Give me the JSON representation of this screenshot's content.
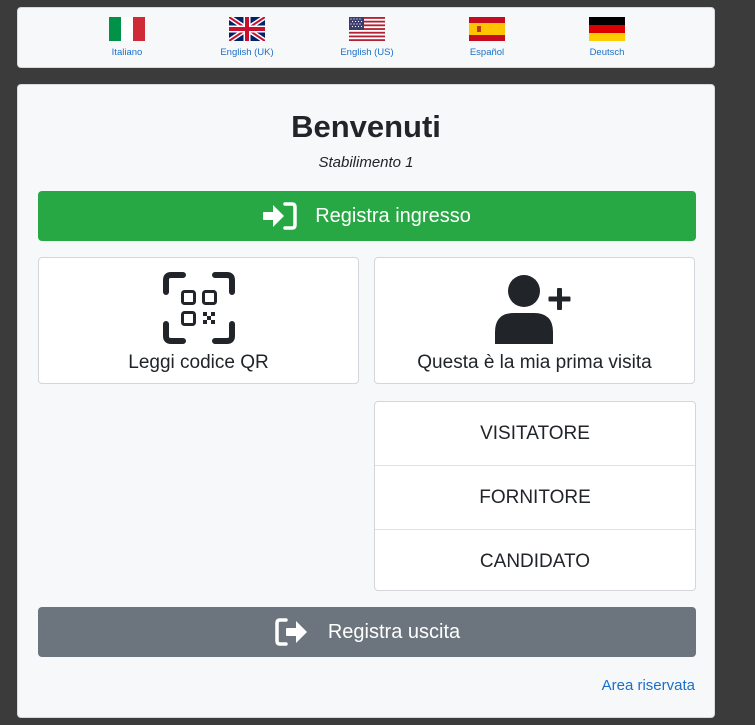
{
  "languages": [
    {
      "label": "Italiano",
      "flag": "it-flag-icon"
    },
    {
      "label": "English (UK)",
      "flag": "uk-flag-icon"
    },
    {
      "label": "English (US)",
      "flag": "us-flag-icon"
    },
    {
      "label": "Español",
      "flag": "es-flag-icon"
    },
    {
      "label": "Deutsch",
      "flag": "de-flag-icon"
    }
  ],
  "main": {
    "title": "Benvenuti",
    "subtitle": "Stabilimento 1",
    "checkin_label": "Registra ingresso",
    "qr_label": "Leggi codice QR",
    "first_visit_label": "Questa è la mia prima visita",
    "visitor_types": [
      "VISITATORE",
      "FORNITORE",
      "CANDIDATO"
    ],
    "checkout_label": "Registra uscita",
    "reserved_link": "Area riservata"
  },
  "colors": {
    "background": "#3b3b3b",
    "card": "#f7f8f9",
    "success": "#28a745",
    "secondary": "#6c757d",
    "link": "#1a6fc9"
  },
  "icons": {
    "checkin": "sign-in-icon",
    "qr": "qr-scan-icon",
    "first_visit": "user-plus-icon",
    "checkout": "sign-out-icon"
  }
}
